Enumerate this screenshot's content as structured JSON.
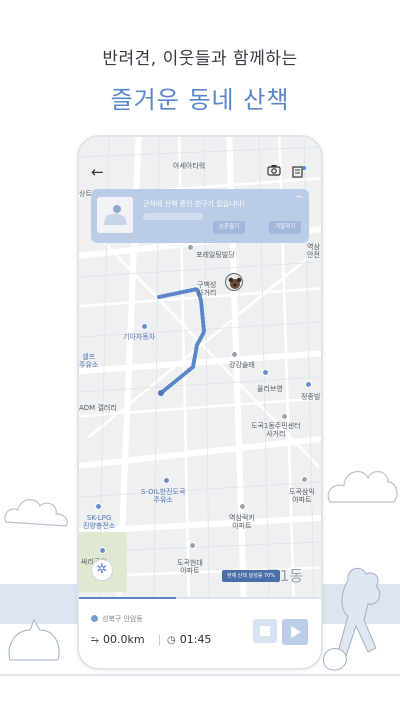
{
  "promo": {
    "line1": "반려견, 이웃들과 함께하는",
    "line2": "즐거운 동네 산책"
  },
  "colors": {
    "accent": "#5a86c8",
    "route": "#5a86c8",
    "notice_bg": "#b9cbe6"
  },
  "topbar": {
    "back_icon": "back-arrow-icon",
    "camera_icon": "camera-icon",
    "list_icon": "list-icon"
  },
  "notice": {
    "message": "근처에 산책 중인 친구가 있습니다!",
    "btn_primary": "손흔들기",
    "btn_secondary": "거절하기"
  },
  "map_labels": {
    "top_center": "아세아타워",
    "top_left": "상트",
    "right_top": "역삼\n안전",
    "poi_1": "포레일팅빌딩",
    "dog_label": "구백성\n사거리",
    "poi_2": "기아자동차",
    "poi_3": "셀프\n주유소",
    "poi_4": "강강술래",
    "poi_5": "올리브영",
    "poi_6": "정종빌딩",
    "poi_7": "ADM 갤러리",
    "poi_8": "도곡1동주민센터\n사거리",
    "poi_9": "S-OIL한진도곡\n주유소",
    "poi_10": "도곡삼익\n아파트",
    "poi_11": "SK-LPG\n진양충전소",
    "poi_12": "역삼럭키\n아파트",
    "poi_13": "싸리공원",
    "poi_14": "도곡현대\n아파트",
    "ghost": "곡1동"
  },
  "toast": "현재 산책 달성률 70%",
  "walk": {
    "progress": 0.4,
    "location": "성북구 안암동",
    "distance": "00.0km",
    "time": "01:45"
  }
}
